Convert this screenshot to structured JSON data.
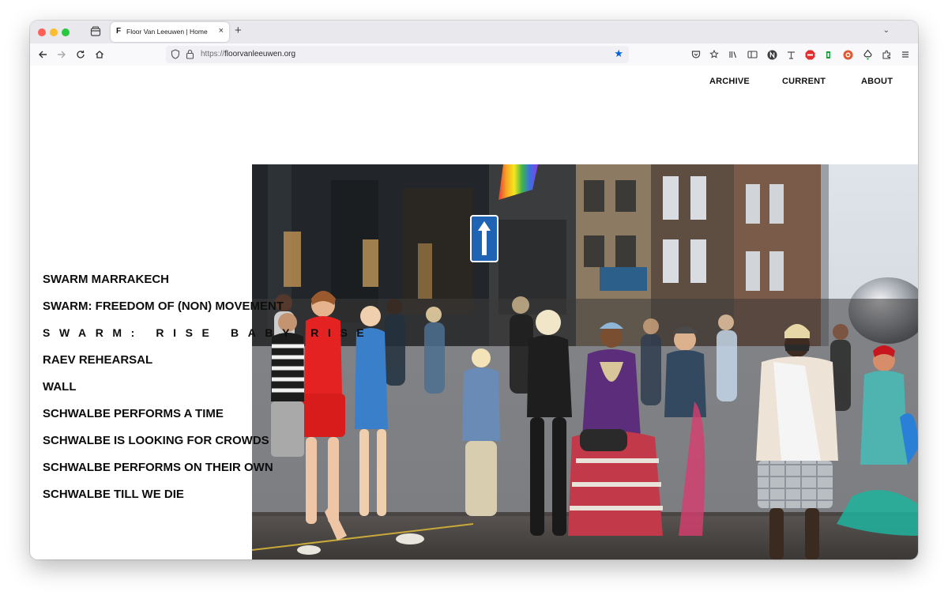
{
  "browser": {
    "tab_title": "Floor Van Leeuwen | Home",
    "tab_favicon": "F",
    "tab_close": "×",
    "new_tab": "+",
    "list_tabs": "⌄",
    "url_protocol": "https://",
    "url_host": "floorvanleeuwen.org"
  },
  "nav": {
    "items": [
      "ARCHIVE",
      "CURRENT",
      "ABOUT"
    ]
  },
  "projects": [
    "SWARM MARRAKECH",
    "SWARM: FREEDOM OF (NON) MOVEMENT",
    "SWARM: RISE BABY RISE",
    "RAEV REHEARSAL",
    "WALL",
    "SCHWALBE PERFORMS A TIME",
    "SCHWALBE IS LOOKING FOR CROWDS",
    "SCHWALBE PERFORMS ON THEIR OWN",
    "SCHWALBE TILL WE DIE"
  ],
  "hero_photo": {
    "subject": "street-party-crowd-photo"
  },
  "colors": {
    "text": "#0d0d0d",
    "accent_link": "#0061e0",
    "hover_highlight": "#2fd6c3"
  }
}
